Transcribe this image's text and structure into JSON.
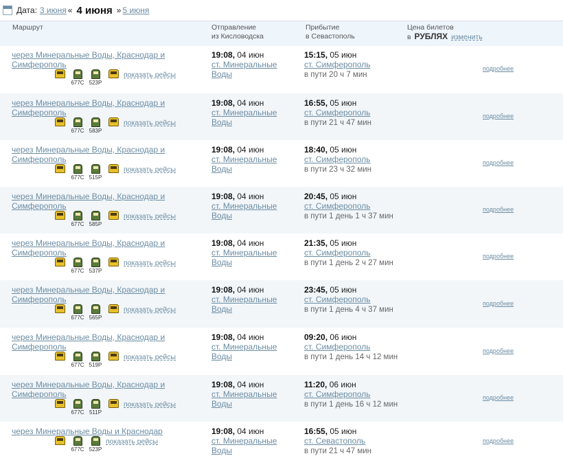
{
  "top": {
    "date_label": "Дата:",
    "prev_date": "3 июня",
    "current_date": "4 июня",
    "next_date": "5 июня",
    "quote_left": "«",
    "quote_right": "»"
  },
  "header": {
    "route": "Маршрут",
    "dep_line1": "Отправление",
    "dep_line2": "из Кисловодска",
    "arr_line1": "Прибытие",
    "arr_line2": "в Севастополь",
    "price_line1": "Цена билетов",
    "price_in": "в",
    "price_currency": "РУБЛЯХ",
    "price_change": "изменить"
  },
  "rows": [
    {
      "route": "через Минеральные Воды, Краснодар и Симферополь",
      "t2": "677С",
      "t3": "523Р",
      "show": "показать рейсы",
      "dep_time": "19:08,",
      "dep_date": "04 июн",
      "dep_station": "ст. Минеральные Воды",
      "arr_time": "15:15,",
      "arr_date": "05 июн",
      "arr_station": "ст. Симферополь",
      "dur": "в пути 20 ч 7 мин",
      "more": "подробнее"
    },
    {
      "route": "через Минеральные Воды, Краснодар и Симферополь",
      "t2": "677С",
      "t3": "583Р",
      "show": "показать рейсы",
      "dep_time": "19:08,",
      "dep_date": "04 июн",
      "dep_station": "ст. Минеральные Воды",
      "arr_time": "16:55,",
      "arr_date": "05 июн",
      "arr_station": "ст. Симферополь",
      "dur": "в пути 21 ч 47 мин",
      "more": "подробнее"
    },
    {
      "route": "через Минеральные Воды, Краснодар и Симферополь",
      "t2": "677С",
      "t3": "515Р",
      "show": "показать рейсы",
      "dep_time": "19:08,",
      "dep_date": "04 июн",
      "dep_station": "ст. Минеральные Воды",
      "arr_time": "18:40,",
      "arr_date": "05 июн",
      "arr_station": "ст. Симферополь",
      "dur": "в пути 23 ч 32 мин",
      "more": "подробнее"
    },
    {
      "route": "через Минеральные Воды, Краснодар и Симферополь",
      "t2": "677С",
      "t3": "585Р",
      "show": "показать рейсы",
      "dep_time": "19:08,",
      "dep_date": "04 июн",
      "dep_station": "ст. Минеральные Воды",
      "arr_time": "20:45,",
      "arr_date": "05 июн",
      "arr_station": "ст. Симферополь",
      "dur": "в пути 1 день 1 ч 37 мин",
      "more": "подробнее"
    },
    {
      "route": "через Минеральные Воды, Краснодар и Симферополь",
      "t2": "677С",
      "t3": "537Р",
      "show": "показать рейсы",
      "dep_time": "19:08,",
      "dep_date": "04 июн",
      "dep_station": "ст. Минеральные Воды",
      "arr_time": "21:35,",
      "arr_date": "05 июн",
      "arr_station": "ст. Симферополь",
      "dur": "в пути 1 день 2 ч 27 мин",
      "more": "подробнее"
    },
    {
      "route": "через Минеральные Воды, Краснодар и Симферополь",
      "t2": "677С",
      "t3": "565Р",
      "show": "показать рейсы",
      "dep_time": "19:08,",
      "dep_date": "04 июн",
      "dep_station": "ст. Минеральные Воды",
      "arr_time": "23:45,",
      "arr_date": "05 июн",
      "arr_station": "ст. Симферополь",
      "dur": "в пути 1 день 4 ч 37 мин",
      "more": "подробнее"
    },
    {
      "route": "через Минеральные Воды, Краснодар и Симферополь",
      "t2": "677С",
      "t3": "519Р",
      "show": "показать рейсы",
      "dep_time": "19:08,",
      "dep_date": "04 июн",
      "dep_station": "ст. Минеральные Воды",
      "arr_time": "09:20,",
      "arr_date": "06 июн",
      "arr_station": "ст. Симферополь",
      "dur": "в пути 1 день 14 ч 12 мин",
      "more": "подробнее"
    },
    {
      "route": "через Минеральные Воды, Краснодар и Симферополь",
      "t2": "677С",
      "t3": "511Р",
      "show": "показать рейсы",
      "dep_time": "19:08,",
      "dep_date": "04 июн",
      "dep_station": "ст. Минеральные Воды",
      "arr_time": "11:20,",
      "arr_date": "06 июн",
      "arr_station": "ст. Симферополь",
      "dur": "в пути 1 день 16 ч 12 мин",
      "more": "подробнее"
    },
    {
      "route": "через Минеральные Воды и Краснодар",
      "t2": "677С",
      "t3": "523Р",
      "show": "показать рейсы",
      "dep_time": "19:08,",
      "dep_date": "04 июн",
      "dep_station": "ст. Минеральные Воды",
      "arr_time": "16:55,",
      "arr_date": "05 июн",
      "arr_station": "ст. Севастополь",
      "dur": "в пути 21 ч 47 мин",
      "more": "подробнее"
    }
  ]
}
